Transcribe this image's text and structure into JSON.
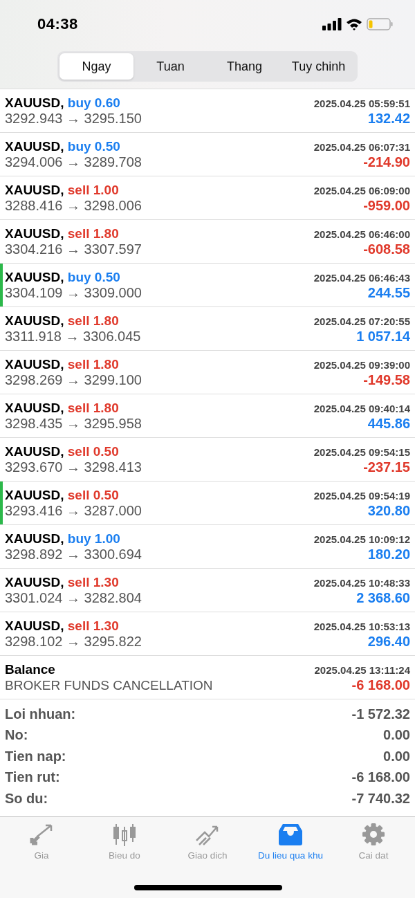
{
  "status_bar": {
    "time": "04:38"
  },
  "period_tabs": [
    {
      "label": "Ngay",
      "selected": true
    },
    {
      "label": "Tuan",
      "selected": false
    },
    {
      "label": "Thang",
      "selected": false
    },
    {
      "label": "Tuy chinh",
      "selected": false
    }
  ],
  "deals": [
    {
      "symbol": "XAUUSD,",
      "order": {
        "text": "buy 0.60",
        "color": "#1a7ef0"
      },
      "time": "2025.04.25 05:59:51",
      "prices": "3292.943 → 3295.150",
      "profit": {
        "text": "132.42",
        "color": "#1a7ef0"
      },
      "marked": false
    },
    {
      "symbol": "XAUUSD,",
      "order": {
        "text": "buy 0.50",
        "color": "#1a7ef0"
      },
      "time": "2025.04.25 06:07:31",
      "prices": "3294.006 → 3289.708",
      "profit": {
        "text": "-214.90",
        "color": "#e0392b"
      },
      "marked": false
    },
    {
      "symbol": "XAUUSD,",
      "order": {
        "text": "sell 1.00",
        "color": "#e0392b"
      },
      "time": "2025.04.25 06:09:00",
      "prices": "3288.416 → 3298.006",
      "profit": {
        "text": "-959.00",
        "color": "#e0392b"
      },
      "marked": false
    },
    {
      "symbol": "XAUUSD,",
      "order": {
        "text": "sell 1.80",
        "color": "#e0392b"
      },
      "time": "2025.04.25 06:46:00",
      "prices": "3304.216 → 3307.597",
      "profit": {
        "text": "-608.58",
        "color": "#e0392b"
      },
      "marked": false
    },
    {
      "symbol": "XAUUSD,",
      "order": {
        "text": "buy 0.50",
        "color": "#1a7ef0"
      },
      "time": "2025.04.25 06:46:43",
      "prices": "3304.109 → 3309.000",
      "profit": {
        "text": "244.55",
        "color": "#1a7ef0"
      },
      "marked": true
    },
    {
      "symbol": "XAUUSD,",
      "order": {
        "text": "sell 1.80",
        "color": "#e0392b"
      },
      "time": "2025.04.25 07:20:55",
      "prices": "3311.918 → 3306.045",
      "profit": {
        "text": "1 057.14",
        "color": "#1a7ef0"
      },
      "marked": false
    },
    {
      "symbol": "XAUUSD,",
      "order": {
        "text": "sell 1.80",
        "color": "#e0392b"
      },
      "time": "2025.04.25 09:39:00",
      "prices": "3298.269 → 3299.100",
      "profit": {
        "text": "-149.58",
        "color": "#e0392b"
      },
      "marked": false
    },
    {
      "symbol": "XAUUSD,",
      "order": {
        "text": "sell 1.80",
        "color": "#e0392b"
      },
      "time": "2025.04.25 09:40:14",
      "prices": "3298.435 → 3295.958",
      "profit": {
        "text": "445.86",
        "color": "#1a7ef0"
      },
      "marked": false
    },
    {
      "symbol": "XAUUSD,",
      "order": {
        "text": "sell 0.50",
        "color": "#e0392b"
      },
      "time": "2025.04.25 09:54:15",
      "prices": "3293.670 → 3298.413",
      "profit": {
        "text": "-237.15",
        "color": "#e0392b"
      },
      "marked": false
    },
    {
      "symbol": "XAUUSD,",
      "order": {
        "text": "sell 0.50",
        "color": "#e0392b"
      },
      "time": "2025.04.25 09:54:19",
      "prices": "3293.416 → 3287.000",
      "profit": {
        "text": "320.80",
        "color": "#1a7ef0"
      },
      "marked": true
    },
    {
      "symbol": "XAUUSD,",
      "order": {
        "text": "buy 1.00",
        "color": "#1a7ef0"
      },
      "time": "2025.04.25 10:09:12",
      "prices": "3298.892 → 3300.694",
      "profit": {
        "text": "180.20",
        "color": "#1a7ef0"
      },
      "marked": false
    },
    {
      "symbol": "XAUUSD,",
      "order": {
        "text": "sell 1.30",
        "color": "#e0392b"
      },
      "time": "2025.04.25 10:48:33",
      "prices": "3301.024 → 3282.804",
      "profit": {
        "text": "2 368.60",
        "color": "#1a7ef0"
      },
      "marked": false
    },
    {
      "symbol": "XAUUSD,",
      "order": {
        "text": "sell 1.30",
        "color": "#e0392b"
      },
      "time": "2025.04.25 10:53:13",
      "prices": "3298.102 → 3295.822",
      "profit": {
        "text": "296.40",
        "color": "#1a7ef0"
      },
      "marked": false
    }
  ],
  "balance": {
    "title": "Balance",
    "time": "2025.04.25 13:11:24",
    "comment": "BROKER FUNDS CANCELLATION",
    "amount": {
      "text": "-6 168.00",
      "color": "#e0392b"
    }
  },
  "summary": [
    {
      "label": "Loi nhuan:",
      "value": "-1 572.32"
    },
    {
      "label": "No:",
      "value": "0.00"
    },
    {
      "label": "Tien nap:",
      "value": "0.00"
    },
    {
      "label": "Tien rut:",
      "value": "-6 168.00"
    },
    {
      "label": "So du:",
      "value": "-7 740.32"
    }
  ],
  "tab_bar": [
    {
      "kind": "quotes",
      "label": "Gia",
      "selected": false
    },
    {
      "kind": "chart",
      "label": "Bieu do",
      "selected": false
    },
    {
      "kind": "trade",
      "label": "Giao dich",
      "selected": false
    },
    {
      "kind": "history",
      "label": "Du lieu qua khu",
      "selected": true
    },
    {
      "kind": "settings",
      "label": "Cai dat",
      "selected": false
    }
  ]
}
